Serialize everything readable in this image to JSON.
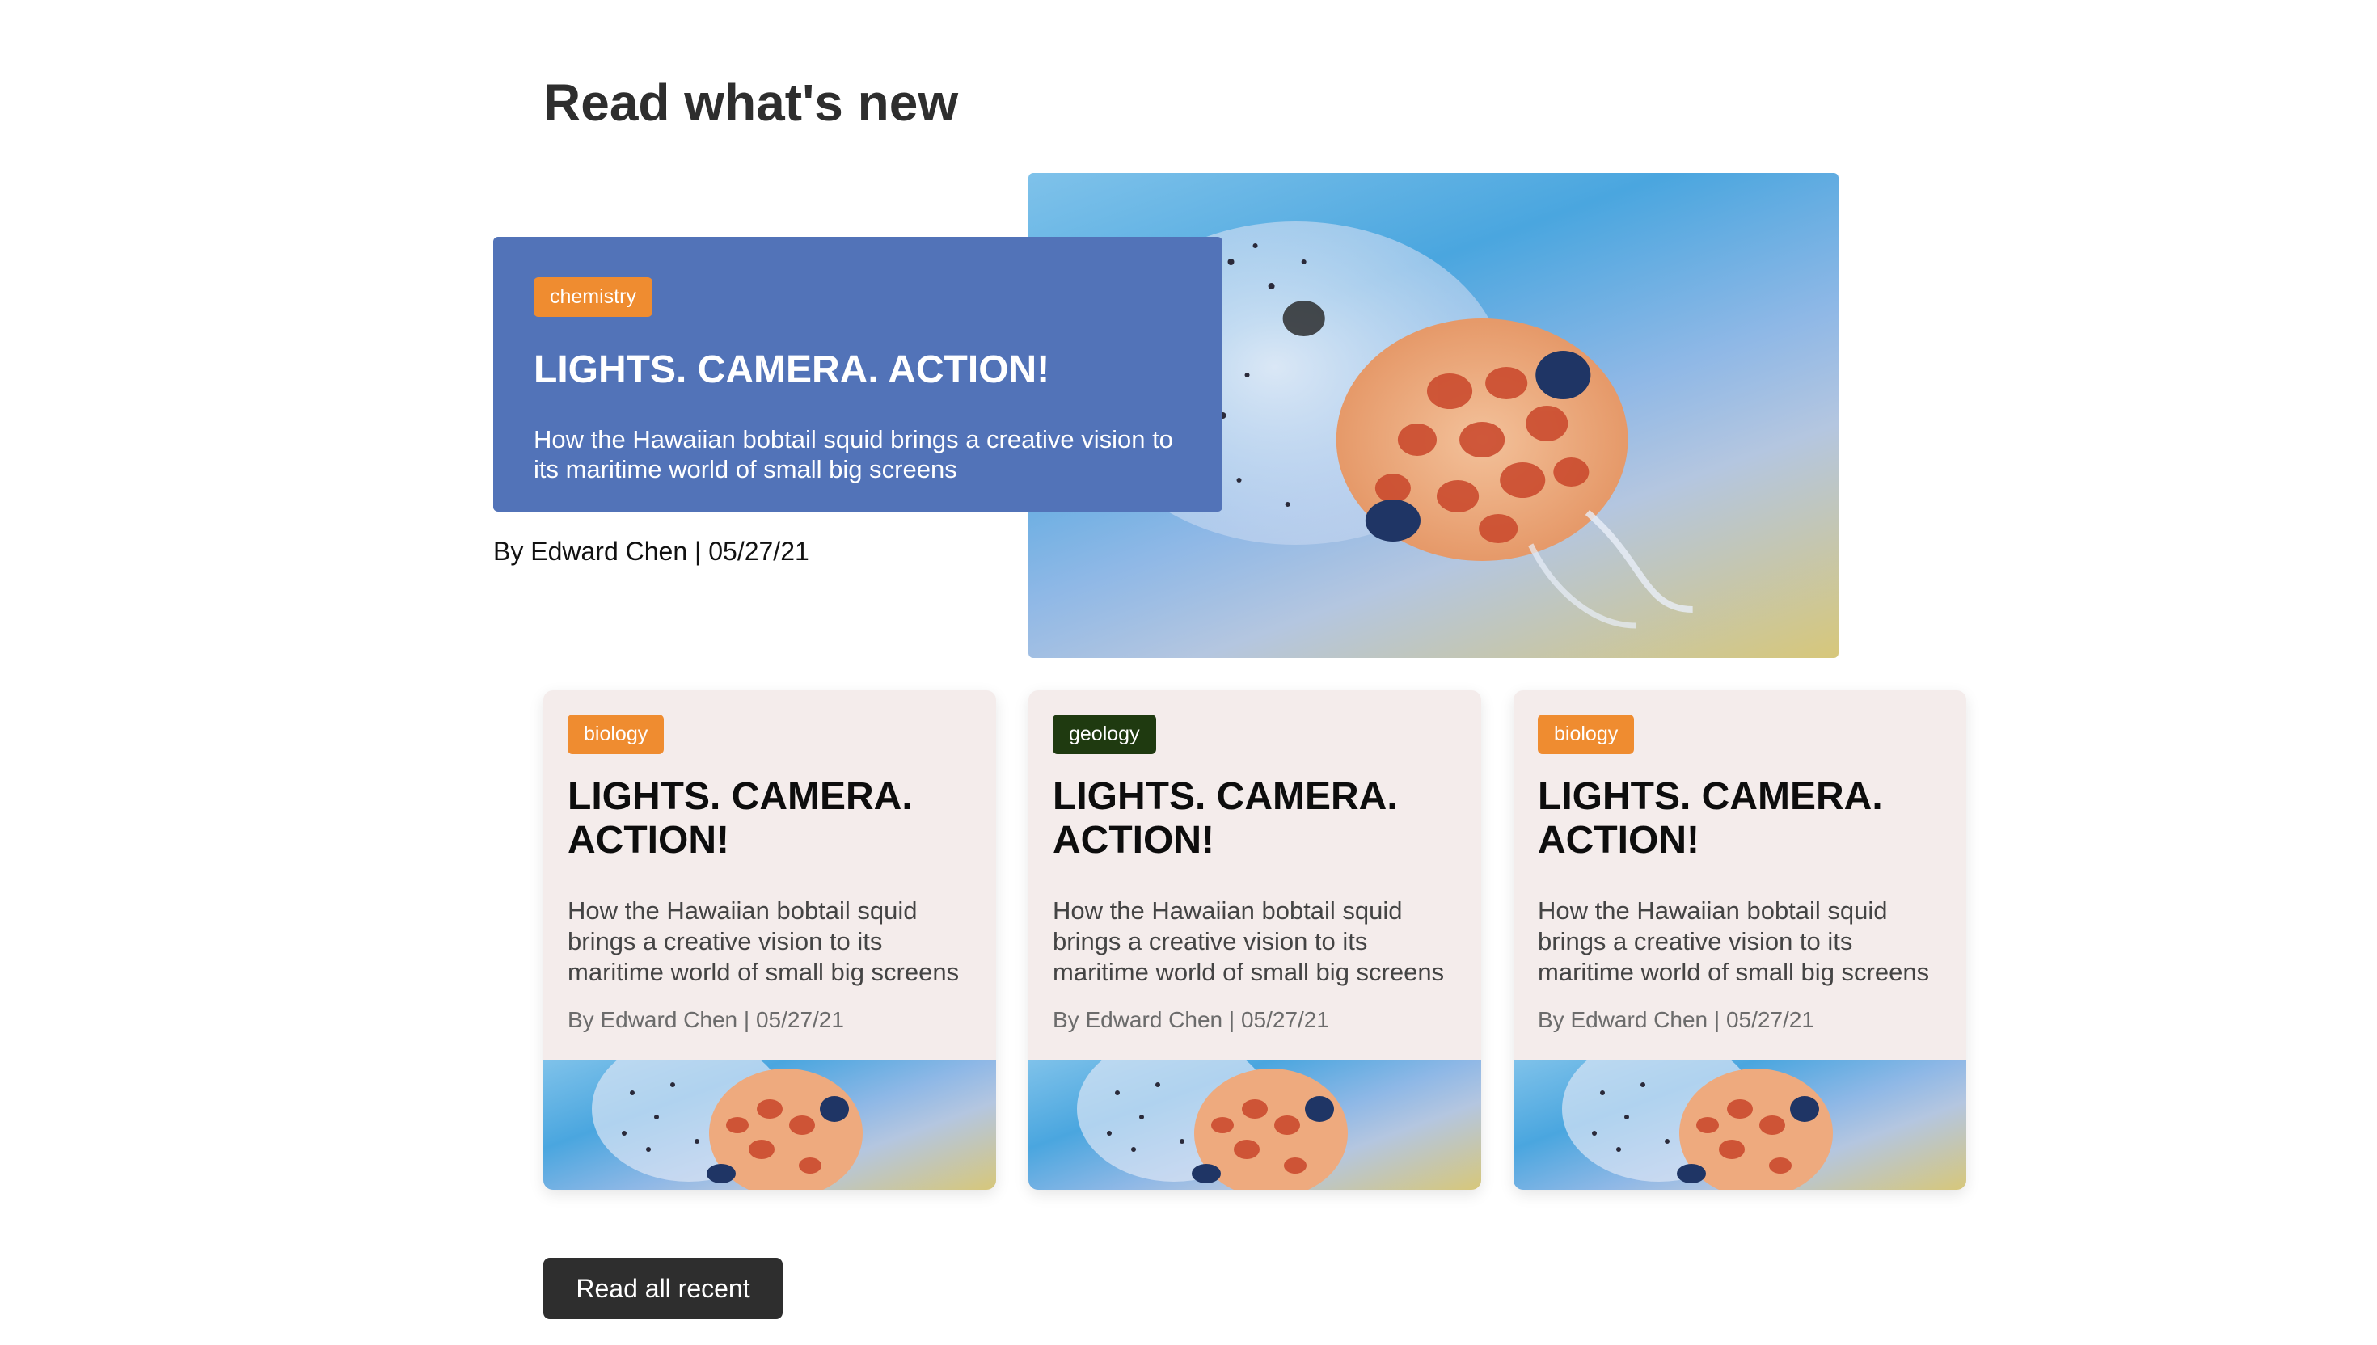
{
  "section": {
    "title": "Read what's new"
  },
  "featured": {
    "tag": "chemistry",
    "title": "LIGHTS. CAMERA. ACTION!",
    "description": "How the Hawaiian bobtail squid brings a creative vision to its maritime world of small big screens",
    "byline": "By Edward Chen | 05/27/21"
  },
  "cards": [
    {
      "tag": "biology",
      "tag_color": "#ef8c30",
      "title": "LIGHTS. CAMERA. ACTION!",
      "description": "How the Hawaiian bobtail squid brings a creative vision to its maritime world of small big screens",
      "byline": "By Edward Chen | 05/27/21"
    },
    {
      "tag": "geology",
      "tag_color": "#1f3a10",
      "title": "LIGHTS. CAMERA. ACTION!",
      "description": "How the Hawaiian bobtail squid brings a creative vision to its maritime world of small big screens",
      "byline": "By Edward Chen | 05/27/21"
    },
    {
      "tag": "biology",
      "tag_color": "#ef8c30",
      "title": "LIGHTS. CAMERA. ACTION!",
      "description": "How the Hawaiian bobtail squid brings a creative vision to its maritime world of small big screens",
      "byline": "By Edward Chen | 05/27/21"
    }
  ],
  "actions": {
    "read_all_label": "Read all recent"
  },
  "colors": {
    "featured_panel": "#5273b8",
    "card_background": "#f4eceb",
    "tag_orange": "#ef8c30",
    "tag_green": "#1f3a10",
    "button": "#2e2e2e"
  },
  "icons": {
    "article_image": "squid-photo"
  }
}
